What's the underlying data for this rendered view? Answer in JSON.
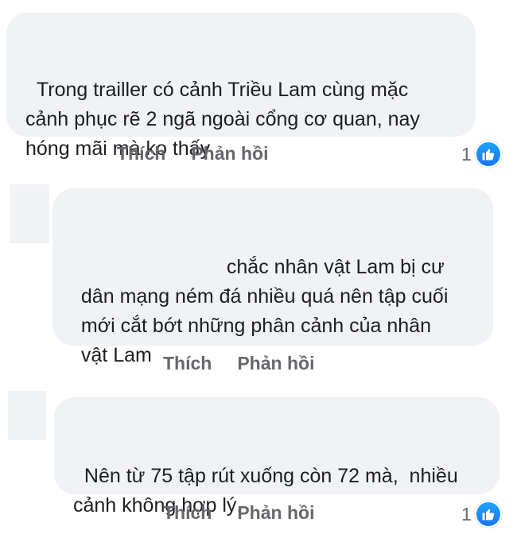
{
  "colors": {
    "bubble": "#f0f2f5",
    "action_text": "#65676b",
    "like_blue": "#1877f2"
  },
  "comments": [
    {
      "text": "Trong trailler có cảnh Triều Lam cùng mặc\ncảnh phục rẽ 2 ngã ngoài cổng cơ quan, nay\nhóng mãi mà ko thấy",
      "like_label": "Thích",
      "reply_label": "Phản hồi",
      "reaction_count": "1",
      "reaction_icon": "thumbs-up-icon"
    },
    {
      "text": "chắc nhân vật Lam bị cư\ndân mạng ném đá nhiều quá nên tập cuối\nmới cắt bớt những phân cảnh của nhân\nvật Lam",
      "like_label": "Thích",
      "reply_label": "Phản hồi"
    },
    {
      "text": "Nên từ 75 tập rút xuống còn 72 mà,  nhiều\ncảnh không hợp lý.",
      "like_label": "Thích",
      "reply_label": "Phản hồi",
      "reaction_count": "1",
      "reaction_icon": "thumbs-up-icon"
    }
  ]
}
